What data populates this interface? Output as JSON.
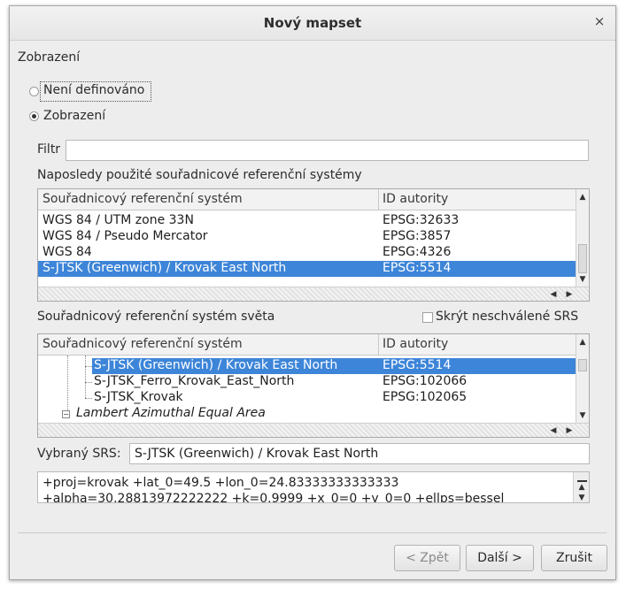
{
  "window": {
    "title": "Nový mapset",
    "close_glyph": "×"
  },
  "section_title": "Zobrazení",
  "radios": [
    {
      "label": "Není definováno",
      "checked": false
    },
    {
      "label": "Zobrazení",
      "checked": true
    }
  ],
  "filter": {
    "label": "Filtr",
    "value": ""
  },
  "recent": {
    "label": "Naposledy použité souřadnicové referenční systémy",
    "columns": [
      "Souřadnicový referenční systém",
      "ID autority"
    ],
    "rows": [
      {
        "name": "WGS 84 / UTM zone 33N",
        "id": "EPSG:32633",
        "selected": false
      },
      {
        "name": "WGS 84 / Pseudo Mercator",
        "id": "EPSG:3857",
        "selected": false
      },
      {
        "name": "WGS 84",
        "id": "EPSG:4326",
        "selected": false
      },
      {
        "name": "S-JTSK (Greenwich) / Krovak East North",
        "id": "EPSG:5514",
        "selected": true
      }
    ]
  },
  "world": {
    "label": "Souřadnicový referenční systém světa",
    "hide_unapproved": {
      "label": "Skrýt neschválené SRS",
      "checked": false
    },
    "columns": [
      "Souřadnicový referenční systém",
      "ID autority"
    ],
    "rows": [
      {
        "name": "S-JTSK (Greenwich) / Krovak East North",
        "id": "EPSG:5514",
        "selected": true
      },
      {
        "name": "S-JTSK_Ferro_Krovak_East_North",
        "id": "EPSG:102066",
        "selected": false
      },
      {
        "name": "S-JTSK_Krovak",
        "id": "EPSG:102065",
        "selected": false
      }
    ],
    "group": "Lambert Azimuthal Equal Area"
  },
  "selected_srs": {
    "label": "Vybraný SRS:",
    "value": "S-JTSK (Greenwich) / Krovak East North"
  },
  "proj_lines": [
    "+proj=krovak +lat_0=49.5 +lon_0=24.83333333333333",
    "+alpha=30.28813972222222 +k=0.9999 +x_0=0 +y_0=0 +ellps=bessel"
  ],
  "buttons": {
    "back": "< Zpět",
    "next": "Další >",
    "cancel": "Zrušit"
  },
  "scroll_glyphs": {
    "up": "▲",
    "down": "▼",
    "left": "◀",
    "right": "▶"
  },
  "tree_minus_glyph": "−"
}
